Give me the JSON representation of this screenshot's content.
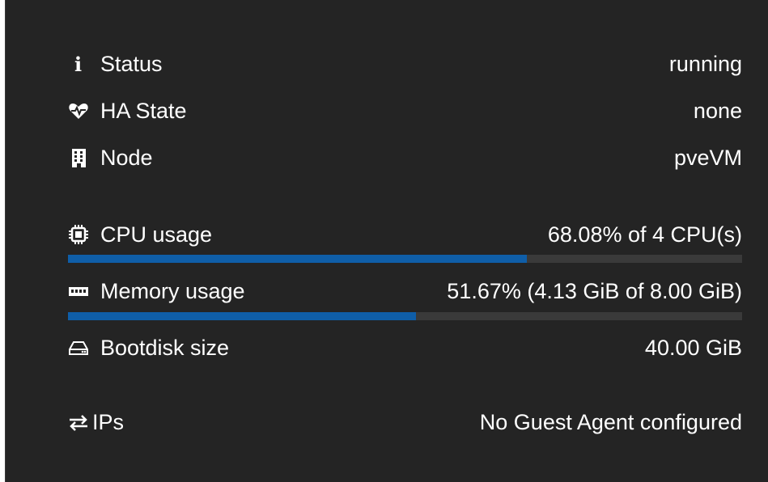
{
  "colors": {
    "panel_background": "#242424",
    "text": "#ffffff",
    "bar_track": "#3a3a3a",
    "bar_fill": "#0f5ea8"
  },
  "summary": {
    "status": {
      "icon": "info-icon",
      "label": "Status",
      "value": "running"
    },
    "ha_state": {
      "icon": "heartbeat-icon",
      "label": "HA State",
      "value": "none"
    },
    "node": {
      "icon": "building-icon",
      "label": "Node",
      "value": "pveVM"
    },
    "cpu": {
      "icon": "cpu-chip-icon",
      "label": "CPU usage",
      "value": "68.08% of 4 CPU(s)",
      "fraction": 0.6808
    },
    "memory": {
      "icon": "memory-icon",
      "label": "Memory usage",
      "value": "51.67% (4.13 GiB of 8.00 GiB)",
      "fraction": 0.5167
    },
    "bootdisk": {
      "icon": "hdd-icon",
      "label": "Bootdisk size",
      "value": "40.00 GiB"
    },
    "ips": {
      "icon": "exchange-icon",
      "label": "IPs",
      "value": "No Guest Agent configured"
    }
  }
}
